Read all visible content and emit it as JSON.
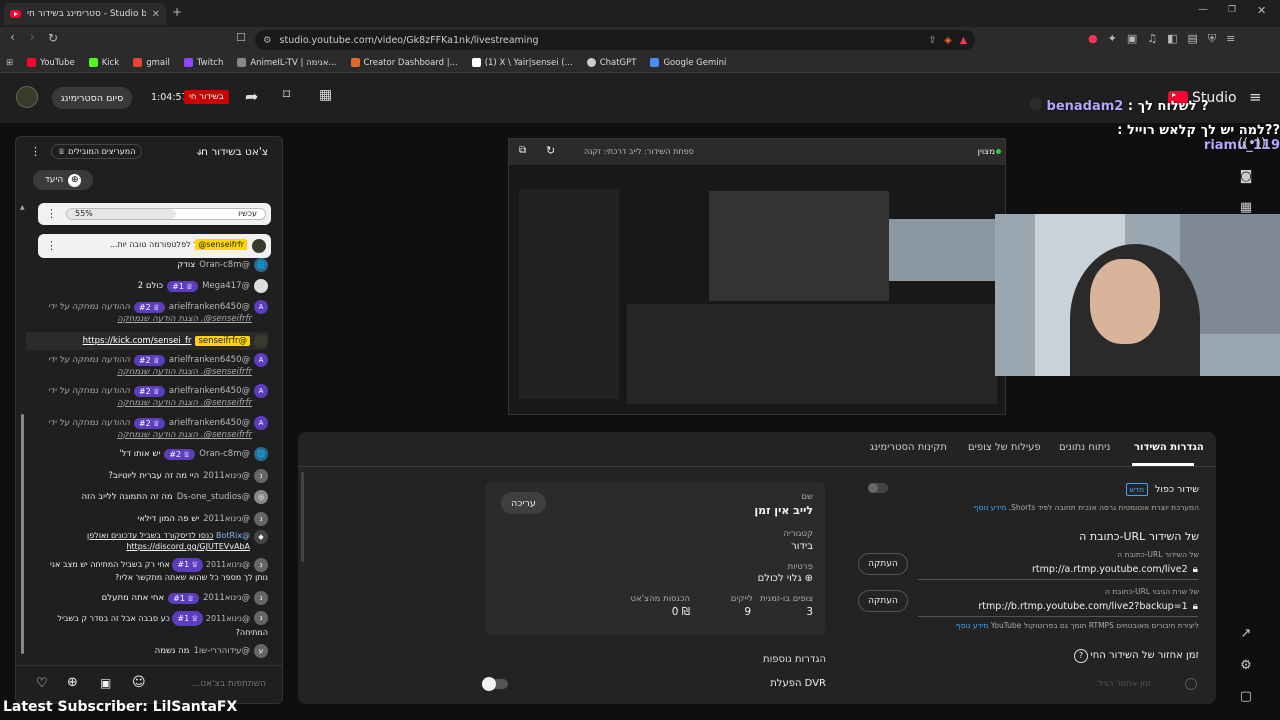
{
  "browser": {
    "tab_title": "סטרימינג בשידור חי - Studio be",
    "url": "studio.youtube.com/video/Gk8zFFKa1nk/livestreaming",
    "bookmarks": [
      {
        "label": "YouTube",
        "color": "#ff0033"
      },
      {
        "label": "Kick",
        "color": "#53fc18"
      },
      {
        "label": "gmail",
        "color": "#ea4335"
      },
      {
        "label": "Twitch",
        "color": "#9146ff"
      },
      {
        "label": "AnimeIL-TV | אנימה...",
        "color": "#888888"
      },
      {
        "label": "Creator Dashboard |...",
        "color": "#e06a2a"
      },
      {
        "label": "(1) X \\ Yair|sensei (...",
        "color": "#ffffff"
      },
      {
        "label": "ChatGPT",
        "color": "#cccccc"
      },
      {
        "label": "Google Gemini",
        "color": "#4e8cf5"
      }
    ]
  },
  "header": {
    "end_stream_label": "סיום הסטרימינג",
    "timer": "1:04:57",
    "live_badge": "בשידור חי",
    "studio_label": "Studio"
  },
  "overlay": {
    "chat_line1_user": "benadam2",
    "chat_line1_text": "? לשלוח לך :",
    "chat_line2_user": "riamu_119",
    "chat_line2_text": "??למה יש לך קלאש רוייל :",
    "latest_subscriber": "Latest Subscriber: LilSantaFX"
  },
  "chat": {
    "title": "צ'אט בשידור חי",
    "top_supporters": "המעריצים המובילים",
    "goal_label": "היעד",
    "poll_label": "עכשיו",
    "poll_value": "55%",
    "pinned_user": "@senseifrfr",
    "pinned_text": "קישור לפלטפורמה טובה יות...",
    "input_placeholder": "השתתפות בצ'אט...",
    "messages": [
      {
        "user": "@Oran-c8m",
        "badge": "",
        "text": "צודק",
        "note": ""
      },
      {
        "user": "@Mega417",
        "badge": "#1",
        "text": "כולם 2",
        "note": ""
      },
      {
        "user": "@arielfranken6450",
        "badge": "#2",
        "text": "ההודעה נמחקה על ידי",
        "note": "senseifrfr@. הצגת הודעה שנמחקה"
      },
      {
        "user": "@senseifrfr",
        "badge": "",
        "text": "https://kick.com/sensei_fr",
        "note": ""
      },
      {
        "user": "@arielfranken6450",
        "badge": "#2",
        "text": "ההודעה נמחקה על ידי",
        "note": "senseifrfr@. הצגת הודעה שנמחקה"
      },
      {
        "user": "@arielfranken6450",
        "badge": "#2",
        "text": "ההודעה נמחקה על ידי",
        "note": "senseifrfr@. הצגת הודעה שנמחקה"
      },
      {
        "user": "@arielfranken6450",
        "badge": "#2",
        "text": "ההודעה נמחקה על ידי",
        "note": "senseifrfr@. הצגת הודעה שנמחקה"
      },
      {
        "user": "@Oran-c8m",
        "badge": "#2",
        "text": "יש אותו דל'",
        "note": ""
      },
      {
        "user": "@נינוא2011",
        "badge": "",
        "text": "היי מה זה עברית ליוטיוב?",
        "note": ""
      },
      {
        "user": "@Ds-one_studios",
        "badge": "",
        "text": "מה זה התמונה ללייב הזה",
        "note": ""
      },
      {
        "user": "@נינוא2011",
        "badge": "",
        "text": "יש פה המון דילאי",
        "note": ""
      },
      {
        "user": "@BotRix",
        "badge": "",
        "text": "כנסו לדיסקורד בשביל עדכונים ואולפן https://discord.gg/GJUTEVvAbA",
        "note": ""
      },
      {
        "user": "@נינוא2011",
        "badge": "#1",
        "text": "אחי רק בשביל המתיחה יש מצב אני נותן לך מספר כל שהוא שאתה מתקשר אליו?",
        "note": ""
      },
      {
        "user": "@נינוא2011",
        "badge": "#1",
        "text": "אחי אתה מתעלם",
        "note": ""
      },
      {
        "user": "@נינוא2011",
        "badge": "#1",
        "text": "כע סבבה אבל זה בסדר ק בשביל המתיחה?",
        "note": ""
      },
      {
        "user": "@עידוהררי-שו1",
        "badge": "",
        "text": "מה נשמה",
        "note": ""
      }
    ]
  },
  "settings": {
    "tabs": [
      "הגדרות השידור",
      "ניתוח נתונים",
      "פעילות של צופים",
      "תקינות הסטרימינג"
    ],
    "dual_broadcast": "שידור כפול",
    "new_badge": "חדש",
    "shorts_desc": "המערכת יוצרת אוטומטית גרסה אנכית תחובה לפיד Shorts.",
    "learn_more": "מידע נוסף",
    "url_title": "כתובת ה-URL של השידור",
    "server_url_label": "כתובת ה-URL של השידור",
    "server_url": "rtmp://a.rtmp.youtube.com/live2",
    "backup_url_label": "כתובת ה-URL של שרת הגיבוי",
    "backup_url": "rtmp://b.rtmp.youtube.com/live2?backup=1",
    "copy_label": "העתקה",
    "rtmps_note": "ליצירת חיבורים מאובטחים RTMPS תומך גם בפרוטוקול YouTube",
    "latency_title": "זמן אחזור של השידור החי",
    "latency_option": "זמן אחזור רגיל",
    "name_label": "שם",
    "name_value": "לייב אין זמן",
    "edit_label": "עריכה",
    "category_label": "קטגוריה",
    "category_value": "בידור",
    "privacy_label": "פרטיות",
    "privacy_value": "גלוי לכולם",
    "concurrent_label": "צופים בו-זמנית",
    "concurrent_value": "3",
    "likes_label": "לייקים",
    "likes_value": "9",
    "revenue_label": "הכנסות מהצ'אט",
    "revenue_value": "₪ 0",
    "more_settings": "הגדרות נוספות",
    "dvr_label": "הפעלת DVR"
  },
  "preview": {
    "address_text": "ספחת השידור: לייב דרכתי: זקנה",
    "live_text": "מצוין"
  },
  "colors": {
    "accent": "#3ea6ff",
    "live": "#cc0000",
    "chip": "#5c3cbf"
  }
}
